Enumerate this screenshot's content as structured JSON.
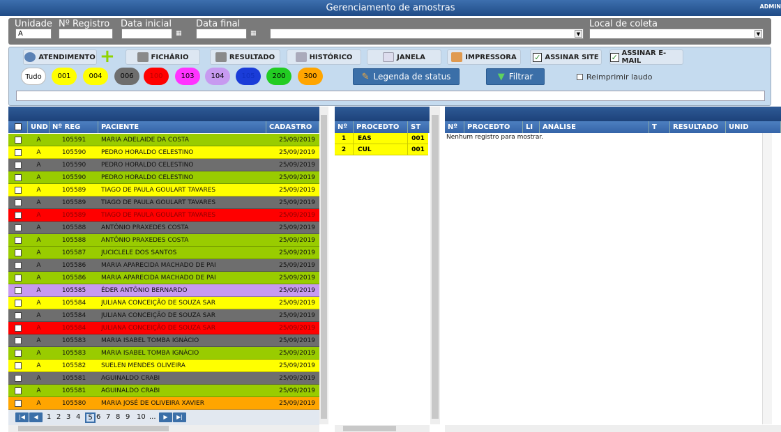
{
  "window": {
    "title": "Gerenciamento de amostras",
    "user": "ADMIN"
  },
  "filters": {
    "unidade_label": "Unidade",
    "unidade_value": "A",
    "registro_label": "Nº Registro",
    "registro_value": "",
    "data_inicial_label": "Data inicial",
    "data_inicial_value": "",
    "data_final_label": "Data final",
    "data_final_value": "",
    "local_label": "Local de coleta",
    "local_value": ""
  },
  "toolbar": {
    "atendimento": "ATENDIMENTO",
    "fichario": "FICHÁRIO",
    "resultado": "RESULTADO",
    "historico": "HISTÓRICO",
    "janela": "JANELA",
    "impressora": "IMPRESSORA",
    "assinar_site": "ASSINAR SITE",
    "assinar_email": "ASSINAR E-MAIL"
  },
  "status_pills": [
    {
      "label": "Tudo",
      "color": "#ffffff",
      "text": "#000000"
    },
    {
      "label": "001",
      "color": "#ffff00",
      "text": "#000000"
    },
    {
      "label": "004",
      "color": "#ffff00",
      "text": "#000000"
    },
    {
      "label": "006",
      "color": "#6e6e6e",
      "text": "#000000"
    },
    {
      "label": "100",
      "color": "#ff0000",
      "text": "#c00000"
    },
    {
      "label": "103",
      "color": "#ff33ff",
      "text": "#000000"
    },
    {
      "label": "104",
      "color": "#c79af0",
      "text": "#000000"
    },
    {
      "label": "105",
      "color": "#1a3cd8",
      "text": "#1030c0"
    },
    {
      "label": "200",
      "color": "#22cc22",
      "text": "#000000"
    },
    {
      "label": "300",
      "color": "#ffa500",
      "text": "#000000"
    }
  ],
  "actions": {
    "legenda": "Legenda de status",
    "filtrar": "Filtrar",
    "reimprimir": "Reimprimir laudo"
  },
  "samples_table": {
    "headers": [
      "UND",
      "Nº REG",
      "PACIENTE",
      "CADASTRO"
    ],
    "rows": [
      {
        "und": "A",
        "reg": "105591",
        "paciente": "MARIA ADELAIDE DA COSTA",
        "cadastro": "25/09/2019",
        "color": "#99cc00"
      },
      {
        "und": "A",
        "reg": "105590",
        "paciente": "PEDRO HORALDO CELESTINO",
        "cadastro": "25/09/2019",
        "color": "#ffff00"
      },
      {
        "und": "A",
        "reg": "105590",
        "paciente": "PEDRO HORALDO CELESTINO",
        "cadastro": "25/09/2019",
        "color": "#6e6e6e"
      },
      {
        "und": "A",
        "reg": "105590",
        "paciente": "PEDRO HORALDO CELESTINO",
        "cadastro": "25/09/2019",
        "color": "#99cc00"
      },
      {
        "und": "A",
        "reg": "105589",
        "paciente": "TIAGO DE PAULA GOULART TAVARES",
        "cadastro": "25/09/2019",
        "color": "#ffff00"
      },
      {
        "und": "A",
        "reg": "105589",
        "paciente": "TIAGO DE PAULA GOULART TAVARES",
        "cadastro": "25/09/2019",
        "color": "#6e6e6e"
      },
      {
        "und": "A",
        "reg": "105589",
        "paciente": "TIAGO DE PAULA GOULART TAVARES",
        "cadastro": "25/09/2019",
        "color": "#ff0000"
      },
      {
        "und": "A",
        "reg": "105588",
        "paciente": "ANTÔNIO PRAXEDES COSTA",
        "cadastro": "25/09/2019",
        "color": "#6e6e6e"
      },
      {
        "und": "A",
        "reg": "105588",
        "paciente": "ANTÔNIO PRAXEDES COSTA",
        "cadastro": "25/09/2019",
        "color": "#99cc00"
      },
      {
        "und": "A",
        "reg": "105587",
        "paciente": "JUCICLELE DOS SANTOS",
        "cadastro": "25/09/2019",
        "color": "#99cc00"
      },
      {
        "und": "A",
        "reg": "105586",
        "paciente": "MARIA APARECIDA MACHADO DE PAI",
        "cadastro": "25/09/2019",
        "color": "#6e6e6e"
      },
      {
        "und": "A",
        "reg": "105586",
        "paciente": "MARIA APARECIDA MACHADO DE PAI",
        "cadastro": "25/09/2019",
        "color": "#99cc00"
      },
      {
        "und": "A",
        "reg": "105585",
        "paciente": "ÉDER ANTÔNIO BERNARDO",
        "cadastro": "25/09/2019",
        "color": "#c79af0"
      },
      {
        "und": "A",
        "reg": "105584",
        "paciente": "JULIANA CONCEIÇÃO DE SOUZA SAR",
        "cadastro": "25/09/2019",
        "color": "#ffff00"
      },
      {
        "und": "A",
        "reg": "105584",
        "paciente": "JULIANA CONCEIÇÃO DE SOUZA SAR",
        "cadastro": "25/09/2019",
        "color": "#6e6e6e"
      },
      {
        "und": "A",
        "reg": "105584",
        "paciente": "JULIANA CONCEIÇÃO DE SOUZA SAR",
        "cadastro": "25/09/2019",
        "color": "#ff0000"
      },
      {
        "und": "A",
        "reg": "105583",
        "paciente": "MARIA ISABEL TOMBA IGNÁCIO",
        "cadastro": "25/09/2019",
        "color": "#6e6e6e"
      },
      {
        "und": "A",
        "reg": "105583",
        "paciente": "MARIA ISABEL TOMBA IGNÁCIO",
        "cadastro": "25/09/2019",
        "color": "#99cc00"
      },
      {
        "und": "A",
        "reg": "105582",
        "paciente": "SUELEN MENDES OLIVEIRA",
        "cadastro": "25/09/2019",
        "color": "#ffff00"
      },
      {
        "und": "A",
        "reg": "105581",
        "paciente": "AGUINALDO CRABI",
        "cadastro": "25/09/2019",
        "color": "#6e6e6e"
      },
      {
        "und": "A",
        "reg": "105581",
        "paciente": "AGUINALDO CRABI",
        "cadastro": "25/09/2019",
        "color": "#99cc00"
      },
      {
        "und": "A",
        "reg": "105580",
        "paciente": "MARIA JOSÉ DE OLIVEIRA XAVIER",
        "cadastro": "25/09/2019",
        "color": "#ffa500"
      }
    ]
  },
  "pager": {
    "pages": [
      "1",
      "2",
      "3",
      "4",
      "5",
      "6",
      "7",
      "8",
      "9",
      "10",
      "..."
    ],
    "current": "5"
  },
  "procedures_table": {
    "headers": [
      "Nº",
      "PROCEDTO",
      "ST"
    ],
    "rows": [
      {
        "n": "1",
        "proc": "EAS",
        "st": "001"
      },
      {
        "n": "2",
        "proc": "CUL",
        "st": "001"
      }
    ]
  },
  "analysis_table": {
    "headers": [
      "Nº",
      "PROCEDTO",
      "LI",
      "ANÁLISE",
      "T",
      "RESULTADO",
      "UNID"
    ],
    "empty_message": "Nenhum registro para mostrar."
  }
}
